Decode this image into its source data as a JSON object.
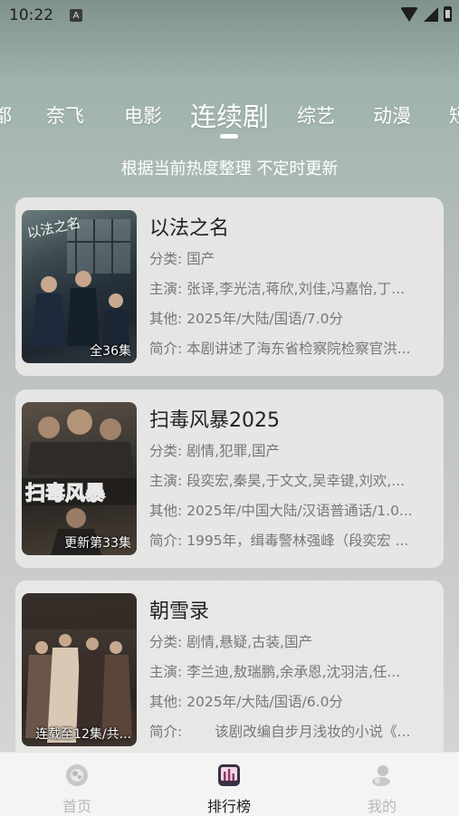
{
  "status": {
    "time": "10:22",
    "notification_icon": "A"
  },
  "tabs": [
    {
      "label": "都"
    },
    {
      "label": "奈飞"
    },
    {
      "label": "电影"
    },
    {
      "label": "连续剧"
    },
    {
      "label": "综艺"
    },
    {
      "label": "动漫"
    },
    {
      "label": "短"
    }
  ],
  "subtitle": "根据当前热度整理 不定时更新",
  "cards": [
    {
      "title": "以法之名",
      "badge": "全36集",
      "genre_label": "分类:",
      "genre": "国产",
      "cast_label": "主演:",
      "cast": "张译,李光洁,蒋欣,刘佳,冯嘉怡,丁...",
      "other_label": "其他:",
      "other": "2025年/大陆/国语/7.0分",
      "intro_label": "简介:",
      "intro": "本剧讲述了海东省检察院检察官洪..."
    },
    {
      "title": "扫毒风暴2025",
      "badge": "更新第33集",
      "genre_label": "分类:",
      "genre": "剧情,犯罪,国产",
      "cast_label": "主演:",
      "cast": "段奕宏,秦昊,于文文,吴幸键,刘欢,...",
      "other_label": "其他:",
      "other": "2025年/中国大陆/汉语普通话/1.0...",
      "intro_label": "简介:",
      "intro": "1995年，缉毒警林强峰（段奕宏 ..."
    },
    {
      "title": "朝雪录",
      "badge": "连载至12集/共...",
      "genre_label": "分类:",
      "genre": "剧情,悬疑,古装,国产",
      "cast_label": "主演:",
      "cast": "李兰迪,敖瑞鹏,余承恩,沈羽洁,任...",
      "other_label": "其他:",
      "other": "2025年/大陆/国语/6.0分",
      "intro_label": "简介:",
      "intro": "　　该剧改编自步月浅妆的小说《..."
    }
  ],
  "nav": {
    "home": "首页",
    "rank": "排行榜",
    "mine": "我的"
  }
}
